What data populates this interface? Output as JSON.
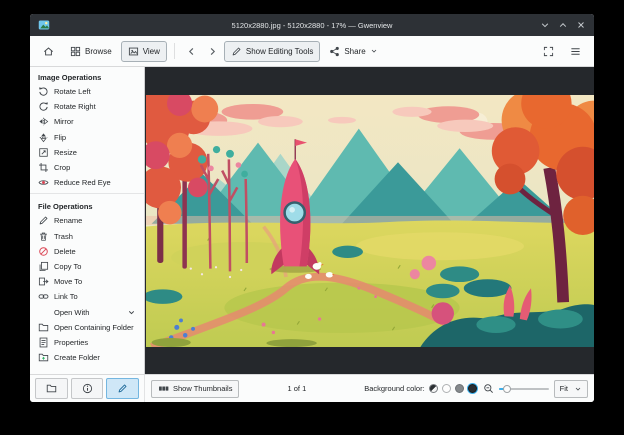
{
  "window": {
    "title": "5120x2880.jpg - 5120x2880 - 17% — Gwenview"
  },
  "toolbar": {
    "browse": "Browse",
    "view": "View",
    "show_editing_tools": "Show Editing Tools",
    "share": "Share"
  },
  "sidebar": {
    "sections": [
      {
        "header": "Image Operations",
        "items": [
          {
            "label": "Rotate Left",
            "icon": "rotate-left-icon"
          },
          {
            "label": "Rotate Right",
            "icon": "rotate-right-icon"
          },
          {
            "label": "Mirror",
            "icon": "mirror-icon"
          },
          {
            "label": "Flip",
            "icon": "flip-icon"
          },
          {
            "label": "Resize",
            "icon": "resize-icon"
          },
          {
            "label": "Crop",
            "icon": "crop-icon"
          },
          {
            "label": "Reduce Red Eye",
            "icon": "red-eye-icon"
          }
        ]
      },
      {
        "header": "File Operations",
        "items": [
          {
            "label": "Rename",
            "icon": "rename-icon"
          },
          {
            "label": "Trash",
            "icon": "trash-icon"
          },
          {
            "label": "Delete",
            "icon": "delete-icon"
          },
          {
            "label": "Copy To",
            "icon": "copy-icon"
          },
          {
            "label": "Move To",
            "icon": "move-icon"
          },
          {
            "label": "Link To",
            "icon": "link-icon"
          },
          {
            "label": "Open With",
            "icon": "none",
            "has_submenu": true
          },
          {
            "label": "Open Containing Folder",
            "icon": "folder-icon"
          },
          {
            "label": "Properties",
            "icon": "document-properties-icon"
          },
          {
            "label": "Create Folder",
            "icon": "new-folder-icon"
          }
        ]
      }
    ],
    "tabs": [
      {
        "name": "folders",
        "icon": "folder-icon",
        "active": false
      },
      {
        "name": "information",
        "icon": "info-icon",
        "active": false
      },
      {
        "name": "operations",
        "icon": "pencil-icon",
        "active": true
      }
    ]
  },
  "viewer": {
    "image_description": "Colorful flat illustration: pink rocket standing in a yellow-green meadow with teal mountains, salmon clouds, autumn orange trees on both edges, small white birds and a pale moon"
  },
  "statusbar": {
    "show_thumbnails": "Show Thumbnails",
    "counter": "1 of 1",
    "background_color_label": "Background color:",
    "swatches": [
      {
        "name": "auto",
        "colors": [
          "#2a2e32",
          "#f4f4f4"
        ],
        "selected": false
      },
      {
        "name": "light",
        "color": "#fdfdfd",
        "selected": false
      },
      {
        "name": "neutral",
        "color": "#85898c",
        "selected": false
      },
      {
        "name": "dark",
        "color": "#2a2e32",
        "selected": true
      }
    ],
    "zoom_mode": "Fit",
    "zoom_percent": "17%"
  },
  "colors": {
    "accent": "#3daee9",
    "titlebar_background": "#2d3136",
    "chrome_background": "#fbfcfc",
    "viewer_background": "#25282c"
  }
}
